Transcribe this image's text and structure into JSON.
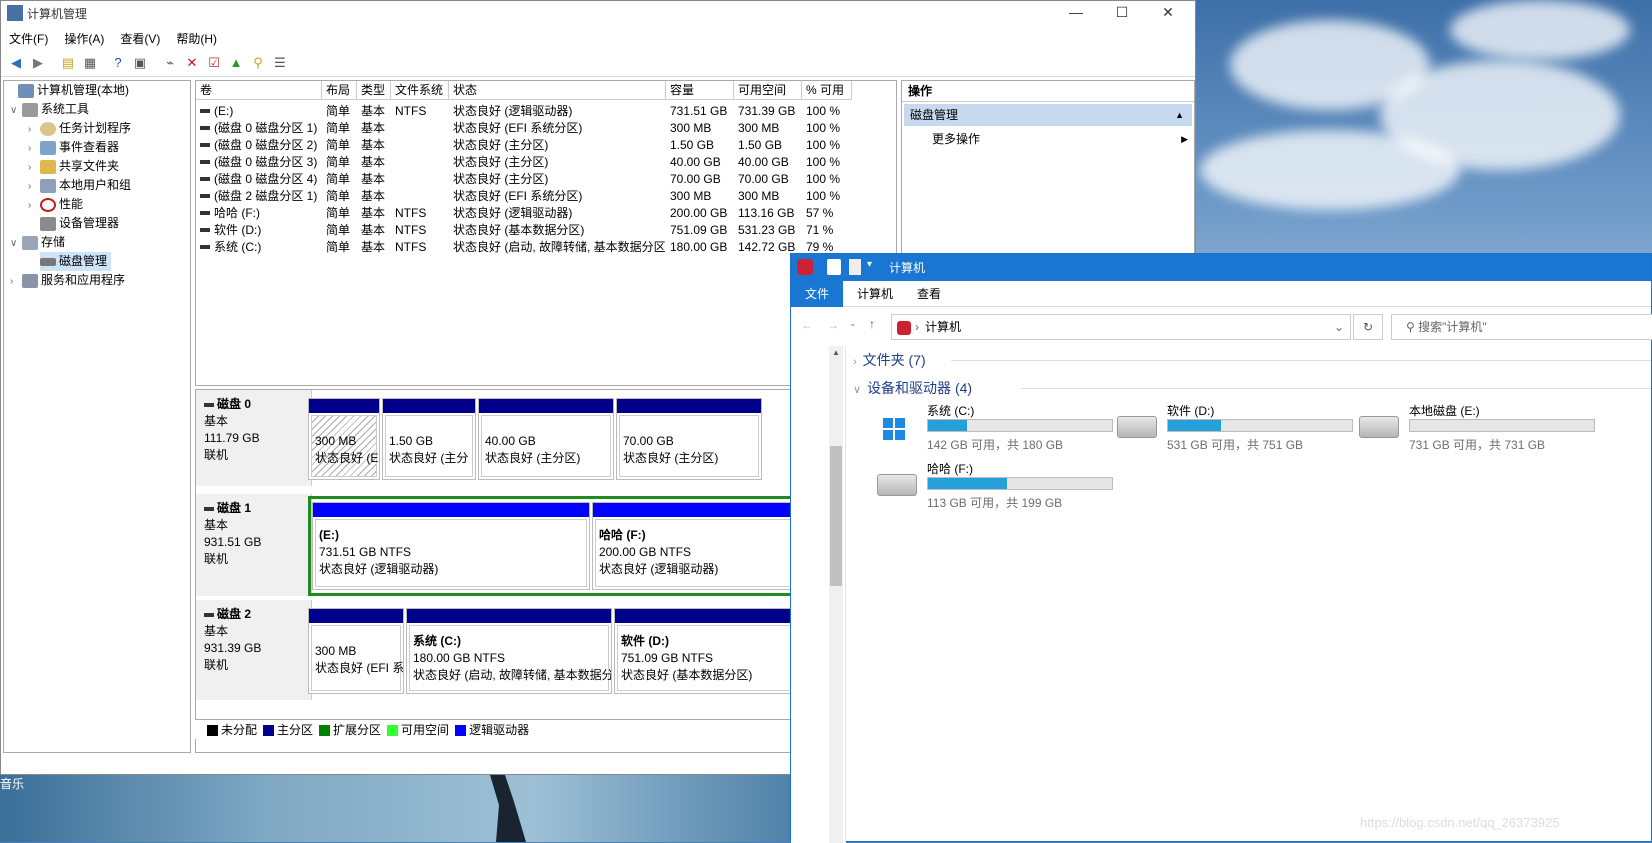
{
  "mmc": {
    "title": "计算机管理",
    "menu": [
      "文件(F)",
      "操作(A)",
      "查看(V)",
      "帮助(H)"
    ],
    "tree": {
      "root": "计算机管理(本地)",
      "system_tools": "系统工具",
      "task_scheduler": "任务计划程序",
      "event_viewer": "事件查看器",
      "shared_folders": "共享文件夹",
      "local_users": "本地用户和组",
      "performance": "性能",
      "device_manager": "设备管理器",
      "storage": "存储",
      "disk_management": "磁盘管理",
      "services": "服务和应用程序"
    },
    "columns": [
      "卷",
      "布局",
      "类型",
      "文件系统",
      "状态",
      "容量",
      "可用空间",
      "% 可用"
    ],
    "volumes": [
      {
        "name": "(E:)",
        "layout": "简单",
        "type": "基本",
        "fs": "NTFS",
        "status": "状态良好 (逻辑驱动器)",
        "capacity": "731.51 GB",
        "free": "731.39 GB",
        "pct": "100 %"
      },
      {
        "name": "(磁盘 0 磁盘分区 1)",
        "layout": "简单",
        "type": "基本",
        "fs": "",
        "status": "状态良好 (EFI 系统分区)",
        "capacity": "300 MB",
        "free": "300 MB",
        "pct": "100 %"
      },
      {
        "name": "(磁盘 0 磁盘分区 2)",
        "layout": "简单",
        "type": "基本",
        "fs": "",
        "status": "状态良好 (主分区)",
        "capacity": "1.50 GB",
        "free": "1.50 GB",
        "pct": "100 %"
      },
      {
        "name": "(磁盘 0 磁盘分区 3)",
        "layout": "简单",
        "type": "基本",
        "fs": "",
        "status": "状态良好 (主分区)",
        "capacity": "40.00 GB",
        "free": "40.00 GB",
        "pct": "100 %"
      },
      {
        "name": "(磁盘 0 磁盘分区 4)",
        "layout": "简单",
        "type": "基本",
        "fs": "",
        "status": "状态良好 (主分区)",
        "capacity": "70.00 GB",
        "free": "70.00 GB",
        "pct": "100 %"
      },
      {
        "name": "(磁盘 2 磁盘分区 1)",
        "layout": "简单",
        "type": "基本",
        "fs": "",
        "status": "状态良好 (EFI 系统分区)",
        "capacity": "300 MB",
        "free": "300 MB",
        "pct": "100 %"
      },
      {
        "name": "哈哈 (F:)",
        "layout": "简单",
        "type": "基本",
        "fs": "NTFS",
        "status": "状态良好 (逻辑驱动器)",
        "capacity": "200.00 GB",
        "free": "113.16 GB",
        "pct": "57 %"
      },
      {
        "name": "软件 (D:)",
        "layout": "简单",
        "type": "基本",
        "fs": "NTFS",
        "status": "状态良好 (基本数据分区)",
        "capacity": "751.09 GB",
        "free": "531.23 GB",
        "pct": "71 %"
      },
      {
        "name": "系统 (C:)",
        "layout": "简单",
        "type": "基本",
        "fs": "NTFS",
        "status": "状态良好 (启动, 故障转储, 基本数据分区)",
        "capacity": "180.00 GB",
        "free": "142.72 GB",
        "pct": "79 %"
      }
    ],
    "actions": {
      "header": "操作",
      "section": "磁盘管理",
      "more": "更多操作"
    },
    "disks": [
      {
        "name": "磁盘 0",
        "type": "基本",
        "size": "111.79 GB",
        "state": "联机",
        "parts": [
          {
            "l1": "300 MB",
            "l2": "状态良好 (E"
          },
          {
            "l1": "1.50 GB",
            "l2": "状态良好 (主分"
          },
          {
            "l1": "40.00 GB",
            "l2": "状态良好 (主分区)"
          },
          {
            "l1": "70.00 GB",
            "l2": "状态良好 (主分区)"
          }
        ]
      },
      {
        "name": "磁盘 1",
        "type": "基本",
        "size": "931.51 GB",
        "state": "联机",
        "parts": [
          {
            "t": "(E:)",
            "l1": "731.51 GB NTFS",
            "l2": "状态良好 (逻辑驱动器)"
          },
          {
            "t": "哈哈 (F:)",
            "l1": "200.00 GB NTFS",
            "l2": "状态良好 (逻辑驱动器)"
          }
        ]
      },
      {
        "name": "磁盘 2",
        "type": "基本",
        "size": "931.39 GB",
        "state": "联机",
        "parts": [
          {
            "l1": "300 MB",
            "l2": "状态良好 (EFI 系"
          },
          {
            "t": "系统 (C:)",
            "l1": "180.00 GB NTFS",
            "l2": "状态良好 (启动, 故障转储, 基本数据分"
          },
          {
            "t": "软件 (D:)",
            "l1": "751.09 GB NTFS",
            "l2": "状态良好 (基本数据分区)"
          }
        ]
      }
    ],
    "legend": [
      "未分配",
      "主分区",
      "扩展分区",
      "可用空间",
      "逻辑驱动器"
    ],
    "legend_colors": [
      "#000000",
      "#00008b",
      "#008000",
      "#33ff33",
      "#0000ff"
    ]
  },
  "explorer": {
    "title": "计算机",
    "tabs": [
      "文件",
      "计算机",
      "查看"
    ],
    "path": "计算机",
    "search_placeholder": "搜索\"计算机\"",
    "folders_group": "文件夹 (7)",
    "drives_group": "设备和驱动器 (4)",
    "drives": [
      {
        "name": "系统 (C:)",
        "info": "142 GB 可用，共 180 GB",
        "used_fraction": 0.21
      },
      {
        "name": "软件 (D:)",
        "info": "531 GB 可用，共 751 GB",
        "used_fraction": 0.29
      },
      {
        "name": "本地磁盘 (E:)",
        "info": "731 GB 可用，共 731 GB",
        "used_fraction": 0.0
      },
      {
        "name": "哈哈 (F:)",
        "info": "113 GB 可用，共 199 GB",
        "used_fraction": 0.43
      }
    ]
  },
  "desktop": {
    "label": "音乐"
  },
  "watermark": "https://blog.csdn.net/qq_26373925"
}
